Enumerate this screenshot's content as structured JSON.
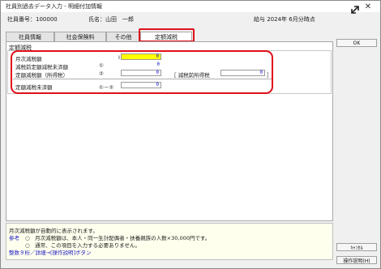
{
  "window": {
    "title": "社員別過去データ入力 - 明細付加情報"
  },
  "info": {
    "employee_no": "社員番号：100000",
    "employee_name": "氏名：山田　一郎",
    "pay_date": "給与 2024年 6月分時点"
  },
  "tabs": [
    {
      "label": "社員情報"
    },
    {
      "label": "社会保険料"
    },
    {
      "label": "その他"
    },
    {
      "label": "定額減税"
    }
  ],
  "section": {
    "title": "定額減税"
  },
  "rows": {
    "monthly": {
      "label": "月次減税額",
      "marker": "I",
      "value": "0"
    },
    "prior_unfinished": {
      "label": "減税前定額減税未済額",
      "marker": "①",
      "value": "0"
    },
    "fixed_tax": {
      "label": "定額減税額（所得税）",
      "marker": "②",
      "value": "0"
    },
    "pre_income_tax": {
      "label": "［ 減税前所得税",
      "value": "0",
      "bracket_end": "］"
    },
    "unfinished": {
      "label": "定額減税未済額",
      "marker": "①－②",
      "value": "0"
    }
  },
  "help": {
    "line1": "月次減税額が自動的に表示されます。",
    "ref_label": "参考",
    "line2": "○　月次減税額は、本人・同一生計配偶者・扶養親族の人数×30,000円です。",
    "line3": "○　通常、この項目を入力する必要ありません。",
    "link": "整数９桁／詳細→[操作説明]ボタン"
  },
  "buttons": {
    "ok": "OK",
    "cancel": "ｷｬﾝｾﾙ",
    "manual": "操作説明(H)"
  }
}
